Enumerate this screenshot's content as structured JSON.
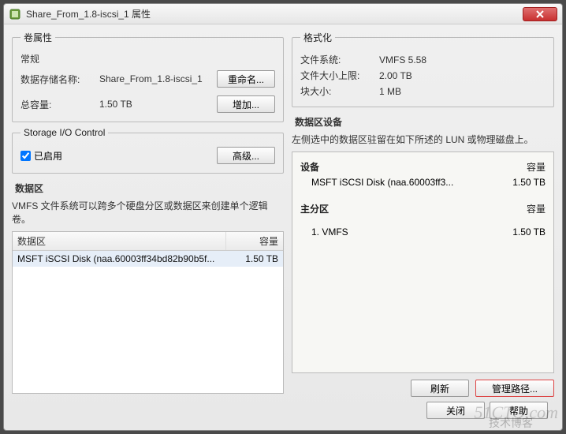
{
  "window": {
    "title": "Share_From_1.8-iscsi_1 属性"
  },
  "volume_props": {
    "legend": "卷属性",
    "general": {
      "title": "常规",
      "datastore_name_label": "数据存储名称:",
      "datastore_name_value": "Share_From_1.8-iscsi_1",
      "capacity_label": "总容量:",
      "capacity_value": "1.50 TB",
      "rename_button": "重命名...",
      "increase_button": "增加..."
    }
  },
  "sioc": {
    "legend": "Storage I/O Control",
    "enabled_label": "已启用",
    "advanced_button": "高级..."
  },
  "format": {
    "legend": "格式化",
    "fs_label": "文件系统:",
    "fs_value": "VMFS 5.58",
    "maxfile_label": "文件大小上限:",
    "maxfile_value": "2.00 TB",
    "block_label": "块大小:",
    "block_value": "1 MB"
  },
  "extents": {
    "title": "数据区",
    "desc": "VMFS 文件系统可以跨多个硬盘分区或数据区来创建单个逻辑卷。",
    "table": {
      "header_name": "数据区",
      "header_cap": "容量",
      "rows": [
        {
          "name": "MSFT iSCSI Disk (naa.60003ff34bd82b90b5f...",
          "cap": "1.50 TB"
        }
      ]
    }
  },
  "extent_device": {
    "title": "数据区设备",
    "desc": "左侧选中的数据区驻留在如下所述的 LUN 或物理磁盘上。",
    "device_heading": "设备",
    "cap_heading": "容量",
    "device_name": "MSFT iSCSI Disk (naa.60003ff3...",
    "device_cap": "1.50 TB",
    "partition_heading": "主分区",
    "partition_cap_heading": "容量",
    "partition_name": "1. VMFS",
    "partition_cap": "1.50 TB",
    "refresh_button": "刷新",
    "manage_paths_button": "管理路径..."
  },
  "footer": {
    "close_button": "关闭",
    "help_button": "帮助"
  },
  "watermark": {
    "main": "51CTO.com",
    "sub": "技术博客"
  }
}
